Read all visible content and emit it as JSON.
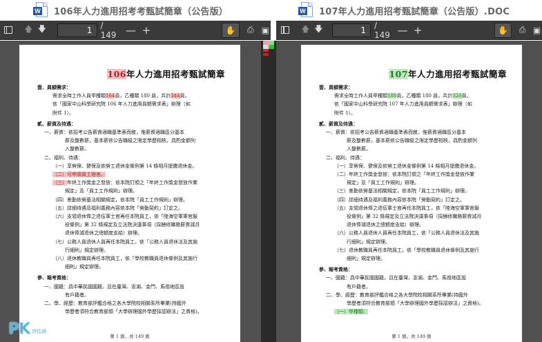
{
  "left": {
    "window_title": "106年人力進用招考考甄試簡章（公告版）",
    "page_number": "1",
    "page_total": "/ 149",
    "zoom_out": "—",
    "zoom_in": "+",
    "doc_title_year": "106",
    "doc_title_rest": "年人力進用招考甄試簡章",
    "footer": "第 1 頁，共 149 頁"
  },
  "right": {
    "window_title": "107年人力進用招考甄試簡章（公告版）.DOC",
    "page_number": "1",
    "page_total": "/ 149",
    "zoom_out": "—",
    "zoom_in": "+",
    "doc_title_year": "107",
    "doc_title_rest": "年人力進用招考甄試簡章",
    "footer": "第 1 頁，共 149 頁"
  },
  "content": {
    "s1": "壹、員額需求：",
    "s1a_pre": "需求全時工作人員甲種類",
    "s1a_left_n1": "164",
    "s1a_right_n1": "188",
    "s1a_mid": "員，乙種類 180 員，共計",
    "s1a_left_n2": "344",
    "s1a_right_n2": "320",
    "s1a_post": "員，",
    "s1b_left": "依「國家中山科學研究院 106 年人力進用員額需求表」辦理（如",
    "s1b_right": "依「國家中山科學研究院 107 年人力進用員額需求表」辦理（如",
    "s1c": "附件 1）。",
    "s2": "貳、薪資及待遇：",
    "s2a": "一、薪資：依招考公告薪資適職基準表而敘，惟薪資適職區分基本",
    "s2b": "薪及整數薪，基本薪依公告職級之限定學歷相核，具酌金額列",
    "s2c": "入整數薪。",
    "s2d": "二、福利、待遇：",
    "s2e": "（一）享勞保、健保及依勞工退休金條例第 14 條相月提繳退休金。",
    "s2f_left": "（二）可申請員工宿舍。",
    "s2f_right": "（二）年終工作獎金發放：依本院訂頒之「年終工作獎金發放作業",
    "s2g_left_tag": "（三）",
    "s2g_left": "年終工作獎金之發放：依本院訂頒之「年終工作獎金發放作業",
    "s2g_right": "規定」及「員工工作規則」辦理。",
    "s2h_left": "規定」及「員工工作規則」辦理。",
    "s2h_right": "（三）差勤依勞基法相關規定，依本院「員工工作規則」辦理。",
    "s2i_left": "（四）差勤依勞基法相關規定，依本院「員工工作規則」辦理。",
    "s2i_right": "（四）詳細待遇及福利義務內容依本院「勞動契約」訂定之。",
    "s2j_left": "（五）詳細待遇及福利義務內容依本院「勞動契約」訂定之。",
    "s2j_right": "（五）支領退休俸之退伍軍士官再任本院員工，依「陸海空軍軍官服",
    "s2k_left": "（六）支領退休俸之退伍軍士官再任本院員工，依「陸海空軍軍官服",
    "s2k_right": "役條例」第 32 條規定及立法院決議事項（採酬修職務薪資減月",
    "s2l_left": "役條例」第 32 條規定及立法院決議事項（採酬修職務薪資減月",
    "s2l_right": "退休俸減退休之總額度支給）辦理。",
    "s2m_left": "退休俸減退休之總額度支給）辦理。",
    "s2m_right": "（六）公務人員退休人員再任本院員工，依「公務人員退休法及其施",
    "s2n_left": "（七）公務人員退休人員再任本院員工，依「公務人員退休法及其施",
    "s2n_right": "行細則」規定辦理。",
    "s2o_left": "行細則」規定辦理。",
    "s2o_right": "（七）退休教職員再任本院員工，依「學校教職員退休條例及其施行",
    "s2p_left": "（八）退休教職員再任本院員工，依「學校教職員退休條例及其施行",
    "s2p_right": "細則」規定辦理。",
    "s2q_left": "細則」規定辦理。",
    "s3": "參、報考資格：",
    "s3a": "一、國籍：具中華民國國籍，且在臺灣、澎湖、金門、馬祖地區設",
    "s3b": "有戶籍者。",
    "s3c": "二、學、經歷：教育部評鑑合格之各大學院校相關系所畢業(持國外",
    "s3d": "學歷者須符合教育部頒「大學辦理國外學歷採認辦法」之資格)。",
    "s3e_right": "（一）甲種類："
  },
  "watermark": {
    "brand": "PK",
    "sub": "評估網"
  }
}
